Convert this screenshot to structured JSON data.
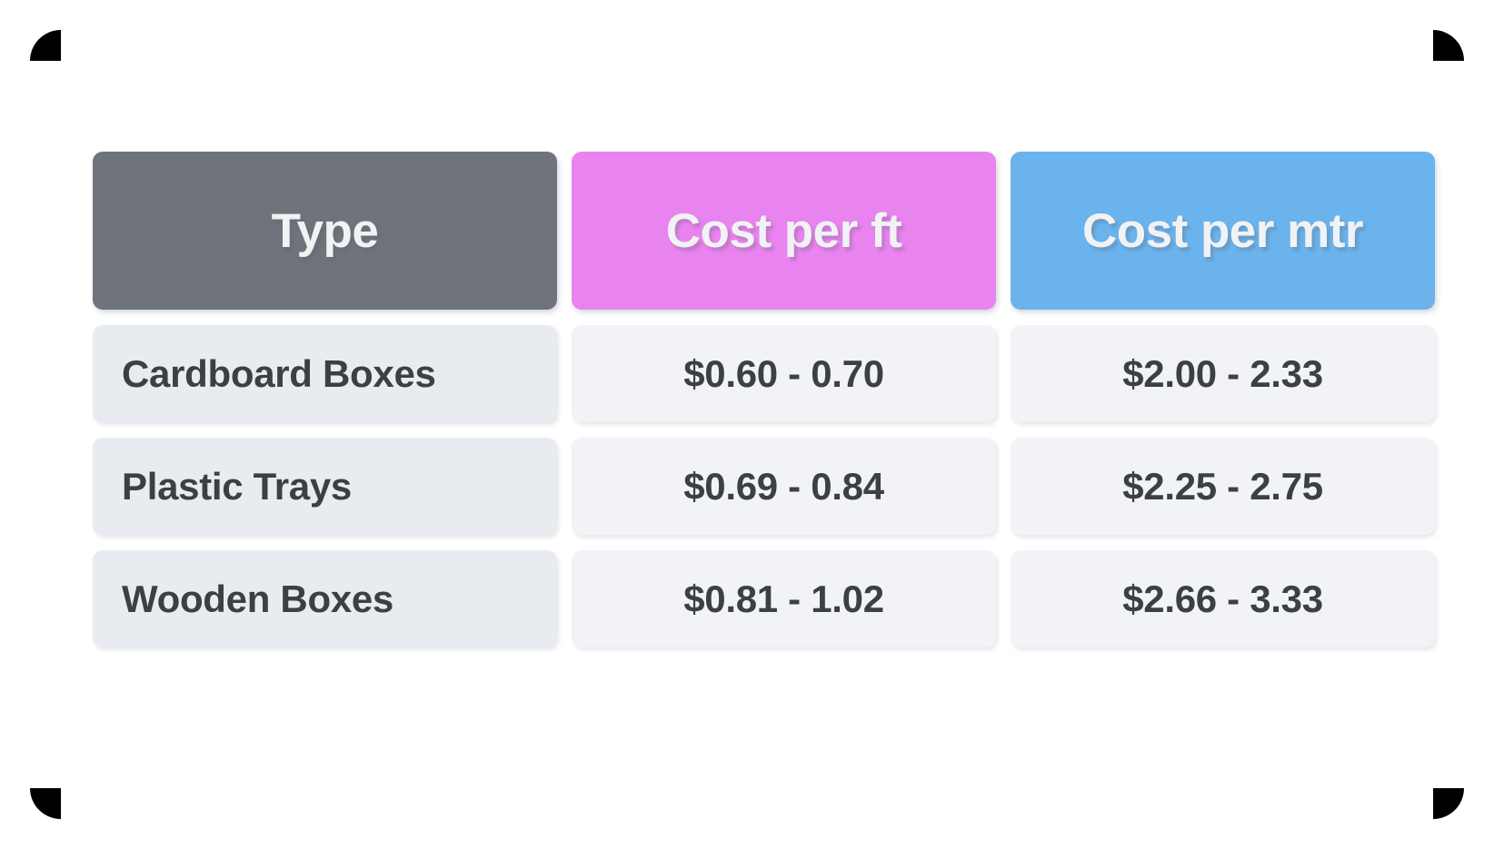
{
  "table": {
    "columns": [
      {
        "key": "type",
        "label": "Type",
        "header_color": "#6F737B",
        "align": "left"
      },
      {
        "key": "cost_ft",
        "label": "Cost per ft",
        "header_color": "#E983EF",
        "align": "center"
      },
      {
        "key": "cost_mtr",
        "label": "Cost per mtr",
        "header_color": "#6BB3EC",
        "align": "center"
      }
    ],
    "rows": [
      {
        "type": "Cardboard Boxes",
        "cost_ft": "$0.60 - 0.70",
        "cost_mtr": "$2.00 - 2.33"
      },
      {
        "type": "Plastic Trays",
        "cost_ft": "$0.69 - 0.84",
        "cost_mtr": "$2.25 - 2.75"
      },
      {
        "type": "Wooden Boxes",
        "cost_ft": "$0.81 - 1.02",
        "cost_mtr": "$2.66 - 3.33"
      }
    ]
  },
  "colors": {
    "header_gray": "#6F737B",
    "header_pink": "#E983EF",
    "header_blue": "#6BB3EC",
    "cell_type_bg": "#E8EBF0",
    "cell_value_bg": "#F2F3F7",
    "header_text": "#F1F2F4",
    "cell_text": "#3C3F44",
    "page_bg": "#FFFFFF",
    "corner_mark": "#000000"
  }
}
